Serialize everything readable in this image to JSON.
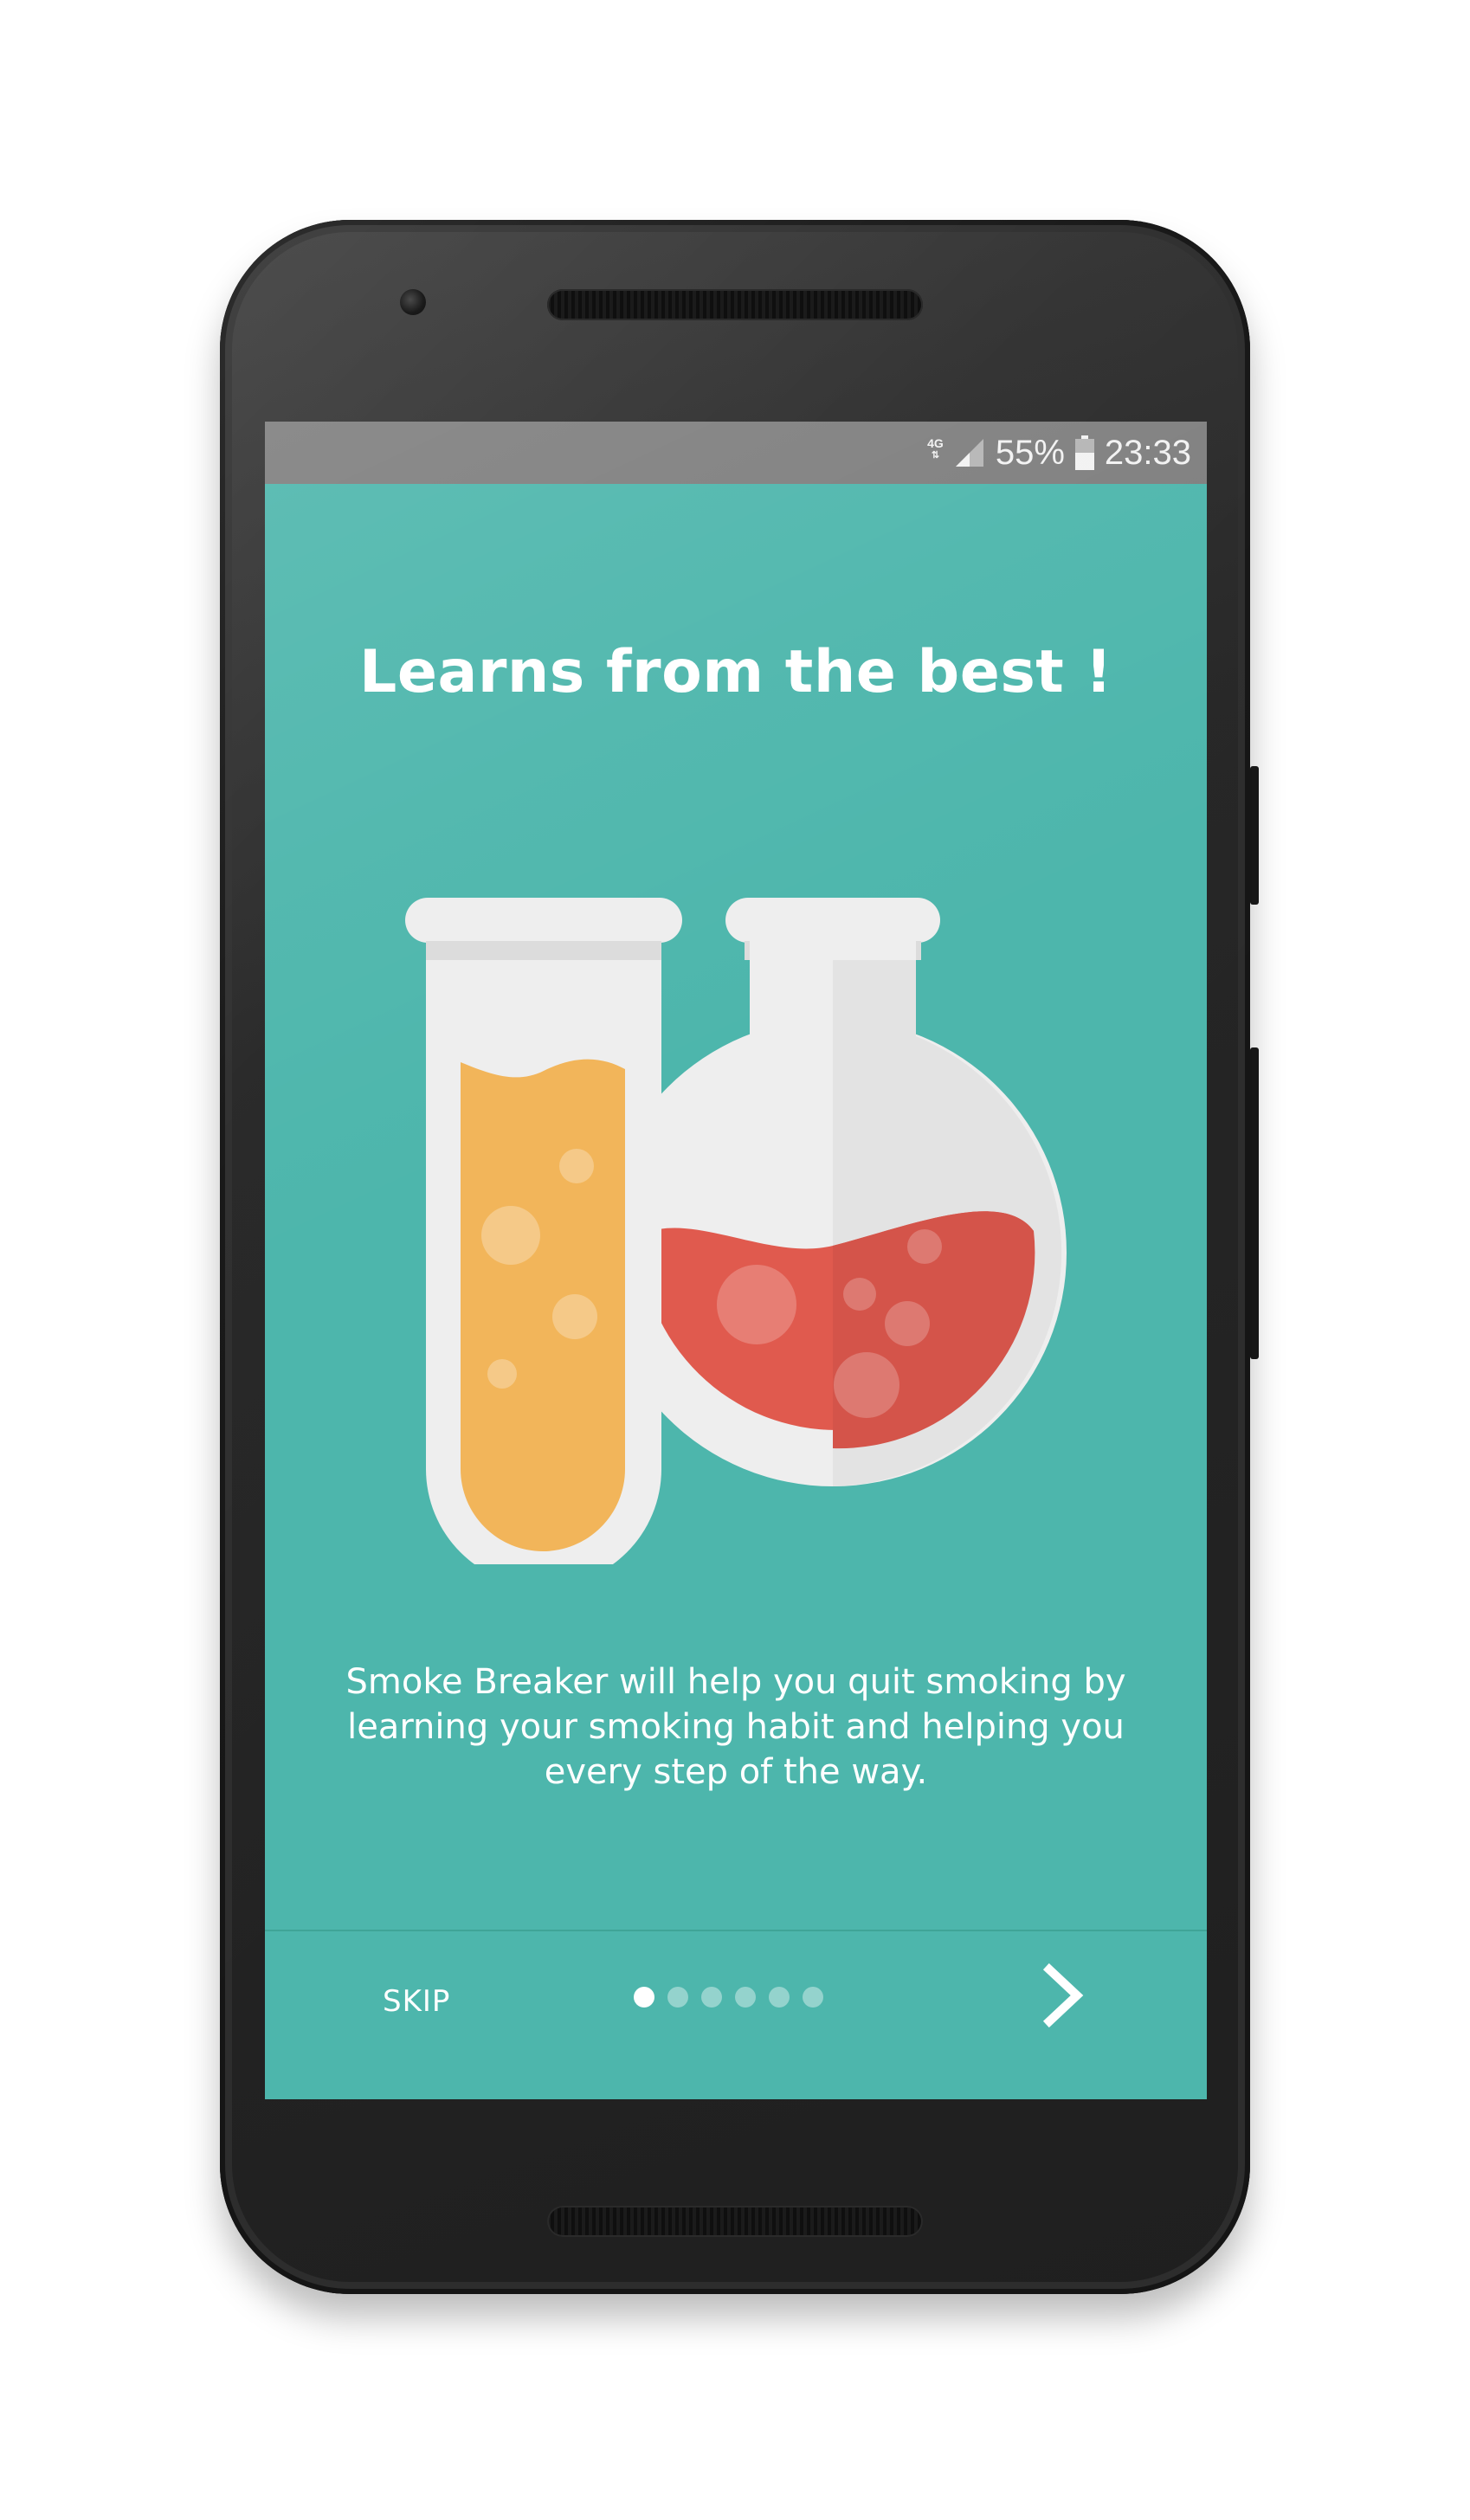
{
  "status_bar": {
    "network": "4G",
    "battery": "55%",
    "time": "23:33"
  },
  "onboarding": {
    "title": "Learns from the best !",
    "description": "Smoke Breaker will help you quit smoking by learning your smoking habit and helping you every step of the way.",
    "illustration_icon": "lab-flasks-icon",
    "skip_label": "SKIP",
    "next_icon": "chevron-right-icon",
    "page_count": 6,
    "current_page": 1
  },
  "colors": {
    "screen_background": "#4db6ac",
    "status_bar": "#7e7e7e",
    "liquid_orange": "#f2b55a",
    "liquid_red": "#e05a4e",
    "glass": "#eeeeee"
  }
}
